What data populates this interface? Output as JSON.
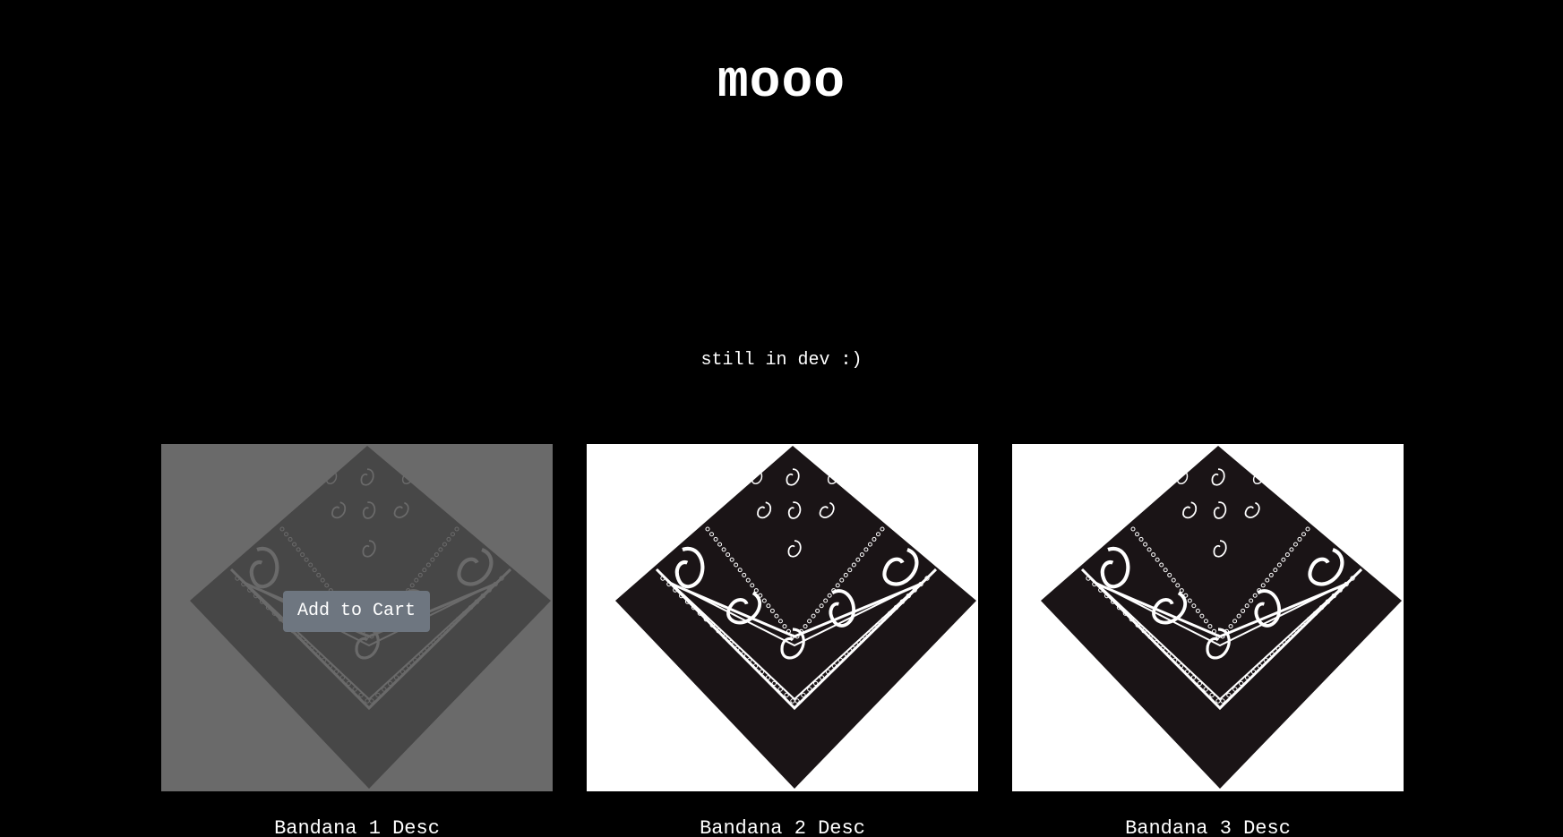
{
  "header": {
    "logo": "mooo",
    "tagline": "still in dev :)"
  },
  "products": [
    {
      "description": "Bandana 1 Desc",
      "image_icon": "bandana-image",
      "hovered": true
    },
    {
      "description": "Bandana 2 Desc",
      "image_icon": "bandana-image",
      "hovered": false
    },
    {
      "description": "Bandana 3 Desc",
      "image_icon": "bandana-image",
      "hovered": false
    }
  ],
  "actions": {
    "add_to_cart_label": "Add to Cart"
  },
  "colors": {
    "background": "#000000",
    "text": "#ffffff",
    "button": "#6e7680",
    "overlay": "#505050"
  }
}
